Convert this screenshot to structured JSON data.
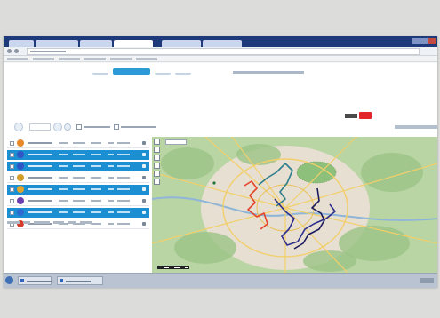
{
  "window": {
    "tab_count": 6,
    "active_tab_index": 3
  },
  "topnav": {
    "items": [
      "",
      "",
      "",
      ""
    ],
    "active_index": 1
  },
  "brand": {
    "tag_color": "#e3262c"
  },
  "accent_color": "#1c8fd3",
  "route_list": {
    "rows": [
      {
        "name": "",
        "icon_color": "#e8892a",
        "selected": false
      },
      {
        "name": "",
        "icon_color": "#2f55c6",
        "selected": true
      },
      {
        "name": "",
        "icon_color": "#2f55c6",
        "selected": true
      },
      {
        "name": "",
        "icon_color": "#d09b28",
        "selected": false
      },
      {
        "name": "",
        "icon_color": "#e2a52b",
        "selected": true
      },
      {
        "name": "",
        "icon_color": "#6b3fb0",
        "selected": false
      },
      {
        "name": "",
        "icon_color": "#2d6bd1",
        "selected": true
      },
      {
        "name": "",
        "icon_color": "#d63b2d",
        "selected": false
      }
    ]
  },
  "map": {
    "route_colors": [
      "#e5452b",
      "#2d7d8a",
      "#2b2e8c",
      "#1b1b5e"
    ],
    "icons": [
      "zoom-in-icon",
      "zoom-out-icon",
      "ruler-icon",
      "layers-icon",
      "polygon-icon",
      "pan-icon"
    ]
  },
  "taskbar": {
    "items": [
      "",
      ""
    ]
  }
}
